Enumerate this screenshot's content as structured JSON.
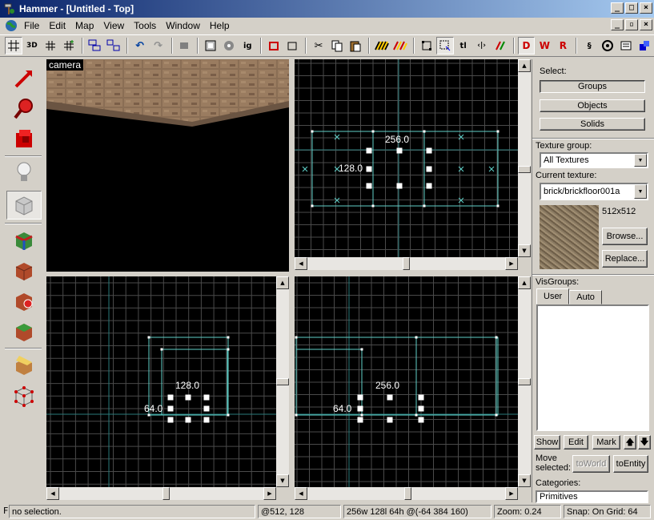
{
  "window": {
    "title": "Hammer - [Untitled - Top]"
  },
  "menu": [
    "File",
    "Edit",
    "Map",
    "View",
    "Tools",
    "Window",
    "Help"
  ],
  "toolbar": {
    "buttons": [
      "grid",
      "3d-grid",
      "small-grid",
      "large-grid",
      "group",
      "ungroup",
      "undo",
      "redo",
      "carve",
      "hide",
      "show",
      "ig",
      "toworld",
      "toentity",
      "cut",
      "copy",
      "paste",
      "texture-lock",
      "texture-apply",
      "select-box",
      "select-handles",
      "tl",
      "flip-h",
      "flip-v",
      "vmf-d",
      "vmf-w",
      "vmf-r",
      "entity-report",
      "check-problems",
      "cordon",
      "run-map"
    ],
    "ig_label": "ig",
    "tl_label": "tl"
  },
  "viewports": {
    "camera_label": "camera",
    "top": {
      "dim_w": "256.0",
      "dim_h": "128.0"
    },
    "front": {
      "dim_w": "128.0",
      "dim_h": "64.0"
    },
    "side": {
      "dim_w": "256.0",
      "dim_h": "64.0"
    }
  },
  "panel": {
    "select_label": "Select:",
    "groups_btn": "Groups",
    "objects_btn": "Objects",
    "solids_btn": "Solids",
    "texture_group_label": "Texture group:",
    "texture_group_value": "All Textures",
    "current_texture_label": "Current texture:",
    "current_texture_value": "brick/brickfloor001a",
    "texture_size": "512x512",
    "browse_btn": "Browse...",
    "replace_btn": "Replace...",
    "visgroups_label": "VisGroups:",
    "tab_user": "User",
    "tab_auto": "Auto",
    "show_btn": "Show",
    "edit_btn": "Edit",
    "mark_btn": "Mark",
    "move_selected_label": "Move\nselected:",
    "toworld_btn": "toWorld",
    "toentity_btn": "toEntity",
    "categories_label": "Categories:",
    "categories_value": "Primitives"
  },
  "status": {
    "f_label": "F",
    "selection": "no selection.",
    "cursor": "@512, 128",
    "size": "256w 128l 64h @(-64 384 160)",
    "zoom": "Zoom: 0.24",
    "snap": "Snap: On Grid: 64"
  },
  "colors": {
    "titlebar_start": "#0a246a",
    "titlebar_end": "#a6caf0",
    "grid_line": "#4a4a4a",
    "grid_major": "#2a7a7a",
    "brush": "#5fd0c8",
    "viewport_bg": "#000000"
  }
}
